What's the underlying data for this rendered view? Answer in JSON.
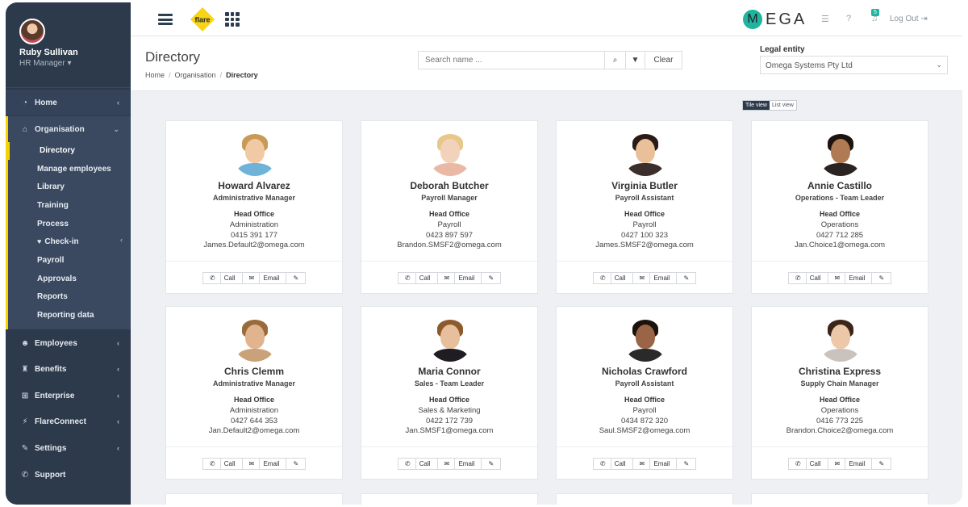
{
  "profile": {
    "name": "Ruby Sullivan",
    "role": "HR Manager ▾"
  },
  "nav": {
    "home": "Home",
    "organisation": "Organisation",
    "sub": [
      "Directory",
      "Manage employees",
      "Library",
      "Training",
      "Process",
      "Check-in",
      "Payroll",
      "Approvals",
      "Reports",
      "Reporting data"
    ],
    "employees": "Employees",
    "benefits": "Benefits",
    "enterprise": "Enterprise",
    "flareconnect": "FlareConnect",
    "settings": "Settings",
    "support": "Support"
  },
  "topbar": {
    "logo_text": "flare",
    "brand": "EGA",
    "brand_m": "M",
    "notifications": "5",
    "logout": "Log Out ⇥"
  },
  "header": {
    "title": "Directory",
    "crumbs": [
      "Home",
      "Organisation",
      "Directory"
    ]
  },
  "search": {
    "placeholder": "Search name ...",
    "clear": "Clear"
  },
  "legal": {
    "label": "Legal entity",
    "value": "Omega Systems Pty Ltd"
  },
  "view_toggle": {
    "tile": "Tile view",
    "list": "List view"
  },
  "actions": {
    "call": "Call",
    "email": "Email"
  },
  "employees": [
    {
      "name": "Howard Alvarez",
      "title": "Administrative Manager",
      "office": "Head Office",
      "dept": "Administration",
      "phone": "0415 391 177",
      "email": "James.Default2@omega.com",
      "skin": "#f1c9a5",
      "hair": "#c79a55",
      "shirt": "#6fb3d9"
    },
    {
      "name": "Deborah Butcher",
      "title": "Payroll Manager",
      "office": "Head Office",
      "dept": "Payroll",
      "phone": "0423 897 597",
      "email": "Brandon.SMSF2@omega.com",
      "skin": "#f3d2bb",
      "hair": "#e8c88a",
      "shirt": "#e9b9a6"
    },
    {
      "name": "Virginia Butler",
      "title": "Payroll Assistant",
      "office": "Head Office",
      "dept": "Payroll",
      "phone": "0427 100 323",
      "email": "James.SMSF2@omega.com",
      "skin": "#e9c09a",
      "hair": "#2a1c15",
      "shirt": "#3a2f2a"
    },
    {
      "name": "Annie Castillo",
      "title": "Operations - Team Leader",
      "office": "Head Office",
      "dept": "Operations",
      "phone": "0427 712 285",
      "email": "Jan.Choice1@omega.com",
      "skin": "#b07a55",
      "hair": "#1d1410",
      "shirt": "#2b2321"
    },
    {
      "name": "Chris Clemm",
      "title": "Administrative Manager",
      "office": "Head Office",
      "dept": "Administration",
      "phone": "0427 644 353",
      "email": "Jan.Default2@omega.com",
      "skin": "#e2b48e",
      "hair": "#9a6b3a",
      "shirt": "#c9a27a"
    },
    {
      "name": "Maria Connor",
      "title": "Sales - Team Leader",
      "office": "Head Office",
      "dept": "Sales & Marketing",
      "phone": "0422 172 739",
      "email": "Jan.SMSF1@omega.com",
      "skin": "#e7bf9c",
      "hair": "#8d5a2c",
      "shirt": "#1f1c22"
    },
    {
      "name": "Nicholas Crawford",
      "title": "Payroll Assistant",
      "office": "Head Office",
      "dept": "Payroll",
      "phone": "0434 872 320",
      "email": "Saul.SMSF2@omega.com",
      "skin": "#9a6446",
      "hair": "#1b120d",
      "shirt": "#2a2a2a"
    },
    {
      "name": "Christina Express",
      "title": "Supply Chain Manager",
      "office": "Head Office",
      "dept": "Operations",
      "phone": "0416 773 225",
      "email": "Brandon.Choice2@omega.com",
      "skin": "#edc8a8",
      "hair": "#3b2418",
      "shirt": "#c9c2bd"
    }
  ]
}
